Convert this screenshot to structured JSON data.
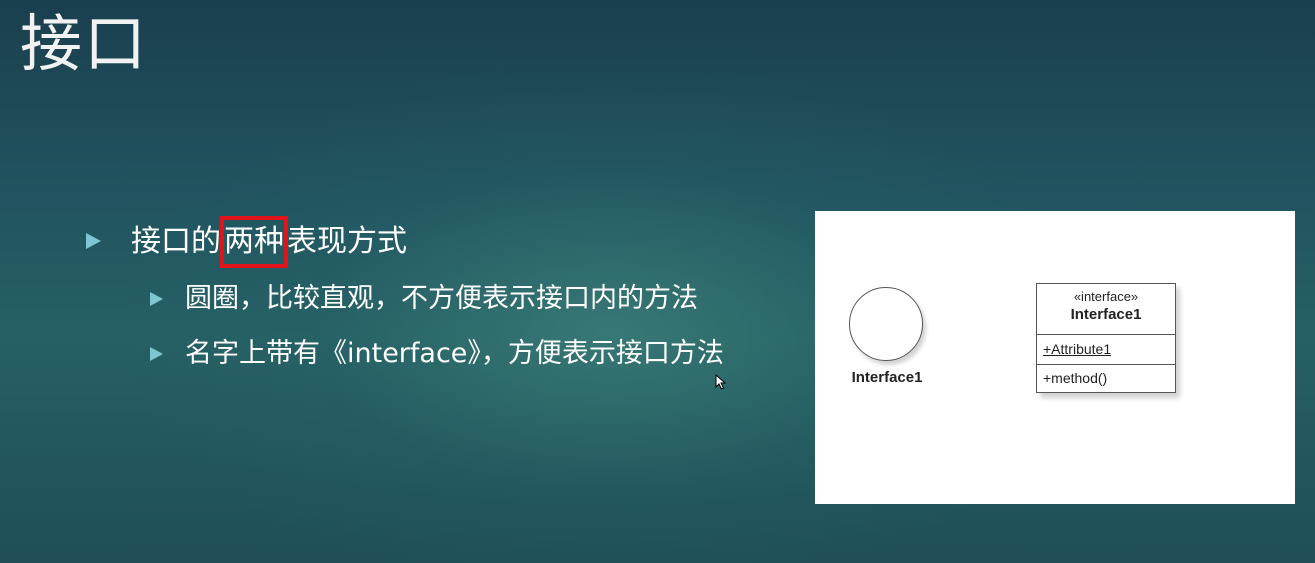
{
  "slide": {
    "title": "接口",
    "bullet1": {
      "before": "接口的",
      "highlight": "两种",
      "after": "表现方式"
    },
    "sub_bullets": [
      "圆圈，比较直观，不方便表示接口内的方法",
      "名字上带有《interface》，方便表示接口方法"
    ]
  },
  "diagram": {
    "circle_label": "Interface1",
    "class_box": {
      "stereotype": "«interface»",
      "name": "Interface1",
      "attribute": "+Attribute1",
      "method": "+method()"
    }
  },
  "colors": {
    "bullet": "#7fc6d3",
    "highlight_border": "#e0141a",
    "text": "#ffffff"
  }
}
